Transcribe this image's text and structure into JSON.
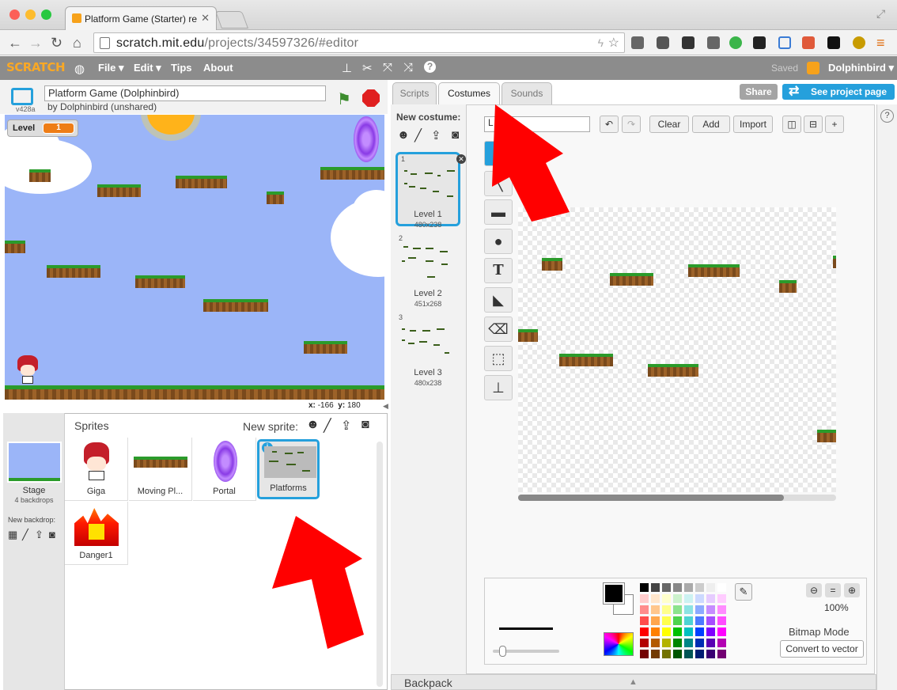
{
  "browser": {
    "tab_title": "Platform Game (Starter) re",
    "url_host": "scratch.mit.edu",
    "url_path": "/projects/34597326/#editor"
  },
  "scratch_header": {
    "logo": "SCRATCH",
    "menus": [
      "File ▾",
      "Edit ▾",
      "Tips",
      "About"
    ],
    "saved_status": "Saved",
    "username": "Dolphinbird ▾"
  },
  "project": {
    "title": "Platform Game (Dolphinbird)",
    "byline": "by Dolphinbird (unshared)",
    "version": "v428a"
  },
  "stage": {
    "variable_name": "Level",
    "variable_value": "1",
    "x_label": "x:",
    "x_value": "-166",
    "y_label": "y:",
    "y_value": "180"
  },
  "sprites_panel": {
    "title": "Sprites",
    "new_sprite_label": "New sprite:",
    "stage_label": "Stage",
    "stage_backdrops": "4 backdrops",
    "new_backdrop_label": "New backdrop:",
    "sprites": [
      "Giga",
      "Moving Pl...",
      "Portal",
      "Platforms",
      "Danger1"
    ]
  },
  "editor": {
    "tabs": [
      "Scripts",
      "Costumes",
      "Sounds"
    ],
    "active_tab": "Costumes",
    "share": "Share",
    "see_project_page": "See project page",
    "new_costume_label": "New costume:",
    "costumes": [
      {
        "num": "1",
        "name": "Level 1",
        "size": "480x238"
      },
      {
        "num": "2",
        "name": "Level 2",
        "size": "451x268"
      },
      {
        "num": "3",
        "name": "Level 3",
        "size": "480x238"
      }
    ],
    "costume_name_value": "L",
    "buttons": {
      "clear": "Clear",
      "add": "Add",
      "import": "Import"
    },
    "zoom": "100%",
    "mode_label": "Bitmap Mode",
    "convert_button": "Convert to vector"
  },
  "backpack": {
    "label": "Backpack"
  },
  "colors": {
    "scratch_bar": "#8c8c8c",
    "accent_blue": "#25a0dc",
    "arrow_red": "#ff0000",
    "stage_sky": "#9bb5f8"
  }
}
